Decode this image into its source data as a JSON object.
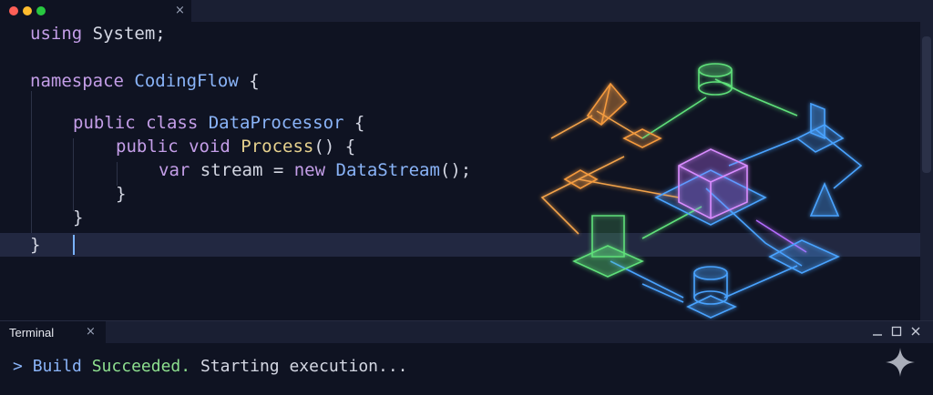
{
  "window": {
    "tab_close": "×"
  },
  "editor": {
    "lines": {
      "l1": {
        "kw": "using",
        "rest": " System;"
      },
      "l2": {
        "kw": "namespace",
        "name": "CodingFlow",
        "rest": " {"
      },
      "l3": {
        "kw": "public class",
        "name": "DataProcessor",
        "rest": " {"
      },
      "l4": {
        "kw": "public void",
        "name": "Process",
        "rest": "() {"
      },
      "l5": {
        "kw": "var",
        "mid": " stream = ",
        "kw2": "new",
        "name": "DataStream",
        "rest": "();"
      },
      "l6": {
        "text": "}"
      },
      "l7": {
        "text": "}"
      },
      "l8": {
        "text": "}"
      }
    }
  },
  "terminal": {
    "tab_label": "Terminal",
    "tab_close": "×",
    "prompt": ">",
    "build": "Build",
    "status": "Succeeded.",
    "rest": "Starting execution..."
  },
  "colors": {
    "background": "#0f1322",
    "keyword": "#c49ee8",
    "type_name": "#8ab4f8",
    "function_name": "#e7d28e",
    "success": "#8ee08f"
  },
  "icons": [
    "close-icon",
    "minimize-icon",
    "maximize-icon",
    "sparkle-icon"
  ]
}
